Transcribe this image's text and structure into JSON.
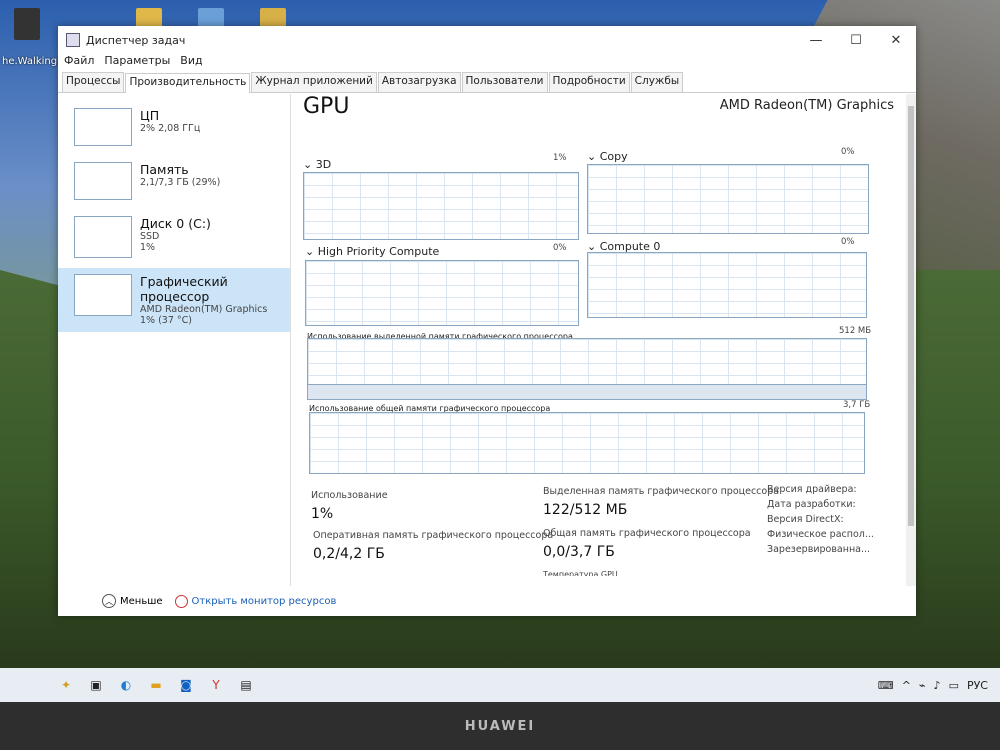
{
  "desktop": {
    "icon_label": "he.Walking..."
  },
  "window": {
    "title": "Диспетчер задач",
    "minimize": "—",
    "maximize": "☐",
    "close": "✕"
  },
  "menu": [
    "Файл",
    "Параметры",
    "Вид"
  ],
  "tabs": [
    "Процессы",
    "Производительность",
    "Журнал приложений",
    "Автозагрузка",
    "Пользователи",
    "Подробности",
    "Службы"
  ],
  "sidebar": [
    {
      "name": "ЦП",
      "line1": "2% 2,08 ГГц",
      "line2": ""
    },
    {
      "name": "Память",
      "line1": "2,1/7,3 ГБ (29%)",
      "line2": ""
    },
    {
      "name": "Диск 0 (C:)",
      "line1": "SSD",
      "line2": "1%"
    },
    {
      "name": "Графический процессор",
      "line1": "AMD Radeon(TM) Graphics",
      "line2": "1% (37 °C)"
    }
  ],
  "gpu": {
    "title": "GPU",
    "device": "AMD Radeon(TM) Graphics",
    "engines": [
      {
        "label": "3D",
        "pct": "1%",
        "value": 1
      },
      {
        "label": "Copy",
        "pct": "0%",
        "value": 0
      },
      {
        "label": "High Priority Compute",
        "pct": "0%",
        "value": 0
      },
      {
        "label": "Compute 0",
        "pct": "0%",
        "value": 0
      }
    ],
    "dedicated_mem": {
      "label": "Использование выделенной памяти графического процессора",
      "max": "512 МБ",
      "fraction": 0.24
    },
    "shared_mem": {
      "label": "Использование общей памяти графического процессора",
      "max": "3,7 ГБ",
      "fraction": 0.0
    }
  },
  "stats": {
    "usage_label": "Использование",
    "usage_value": "1%",
    "dedicated_label": "Выделенная память графического процессора",
    "dedicated_value": "122/512 МБ",
    "ram_label": "Оперативная память графического процессора",
    "ram_value": "0,2/4,2 ГБ",
    "shared_label": "Общая память графического процессора",
    "shared_value": "0,0/3,7 ГБ",
    "temp_label": "Температура GPU",
    "info": [
      "Версия драйвера:",
      "Дата разработки:",
      "Версия DirectX:",
      "Физическое распол...",
      "Зарезервированна..."
    ]
  },
  "footer": {
    "less": "Меньше",
    "monitor": "Открыть монитор ресурсов"
  },
  "taskbar": {
    "lang": "РУС"
  },
  "bezel": "HUAWEI"
}
